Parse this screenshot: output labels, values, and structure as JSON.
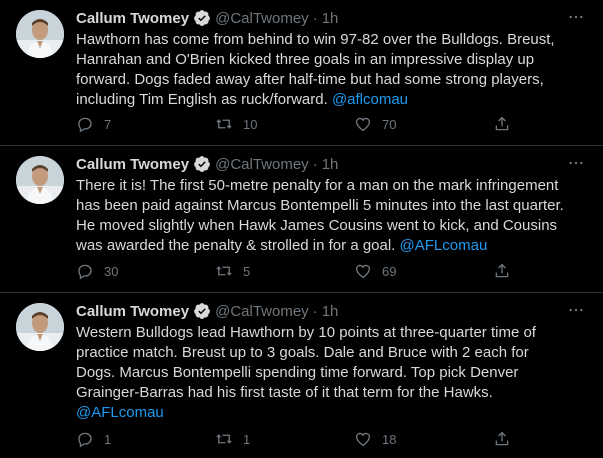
{
  "tweets": [
    {
      "author": "Callum Twomey",
      "handle": "@CalTwomey",
      "dot": "·",
      "time": "1h",
      "lines": [
        "Hawthorn has come from behind to win 97-82 over the Bulldogs. Breust,",
        "Hanrahan and O'Brien kicked three goals in an impressive display up",
        "forward. Dogs faded away after half-time but had some strong players,"
      ],
      "last_line_text": "including Tim English as ruck/forward. ",
      "mention": "@aflcomau",
      "replies": "7",
      "retweets": "10",
      "likes": "70"
    },
    {
      "author": "Callum Twomey",
      "handle": "@CalTwomey",
      "dot": "·",
      "time": "1h",
      "lines": [
        "There it is! The first 50-metre penalty for a man on the mark infringement",
        "has been paid against Marcus Bontempelli 5 minutes into the last quarter.",
        "He moved slightly when Hawk James Cousins went to kick, and Cousins"
      ],
      "last_line_text": "was awarded the penalty & strolled in for a goal. ",
      "mention": "@AFLcomau",
      "replies": "30",
      "retweets": "5",
      "likes": "69"
    },
    {
      "author": "Callum Twomey",
      "handle": "@CalTwomey",
      "dot": "·",
      "time": "1h",
      "lines": [
        "Western Bulldogs lead Hawthorn by 10 points at three-quarter time of",
        "practice match. Breust up to 3 goals. Dale and Bruce with 2 each for",
        "Dogs. Marcus Bontempelli spending time forward. Top pick Denver",
        "Grainger-Barras had his first taste of it that term for the Hawks."
      ],
      "last_line_text": "",
      "mention": "@AFLcomau",
      "replies": "1",
      "retweets": "1",
      "likes": "18"
    }
  ],
  "colors": {
    "background": "#000000",
    "text": "#d9d9d9",
    "muted": "#6e767d",
    "link": "#1d9bf0",
    "verified": "#d9d9d9",
    "divider": "#2f3336"
  },
  "icons": {
    "verified": "verified-badge-icon",
    "more": "more-options-icon",
    "reply": "reply-icon",
    "retweet": "retweet-icon",
    "like": "heart-icon",
    "share": "share-icon"
  }
}
